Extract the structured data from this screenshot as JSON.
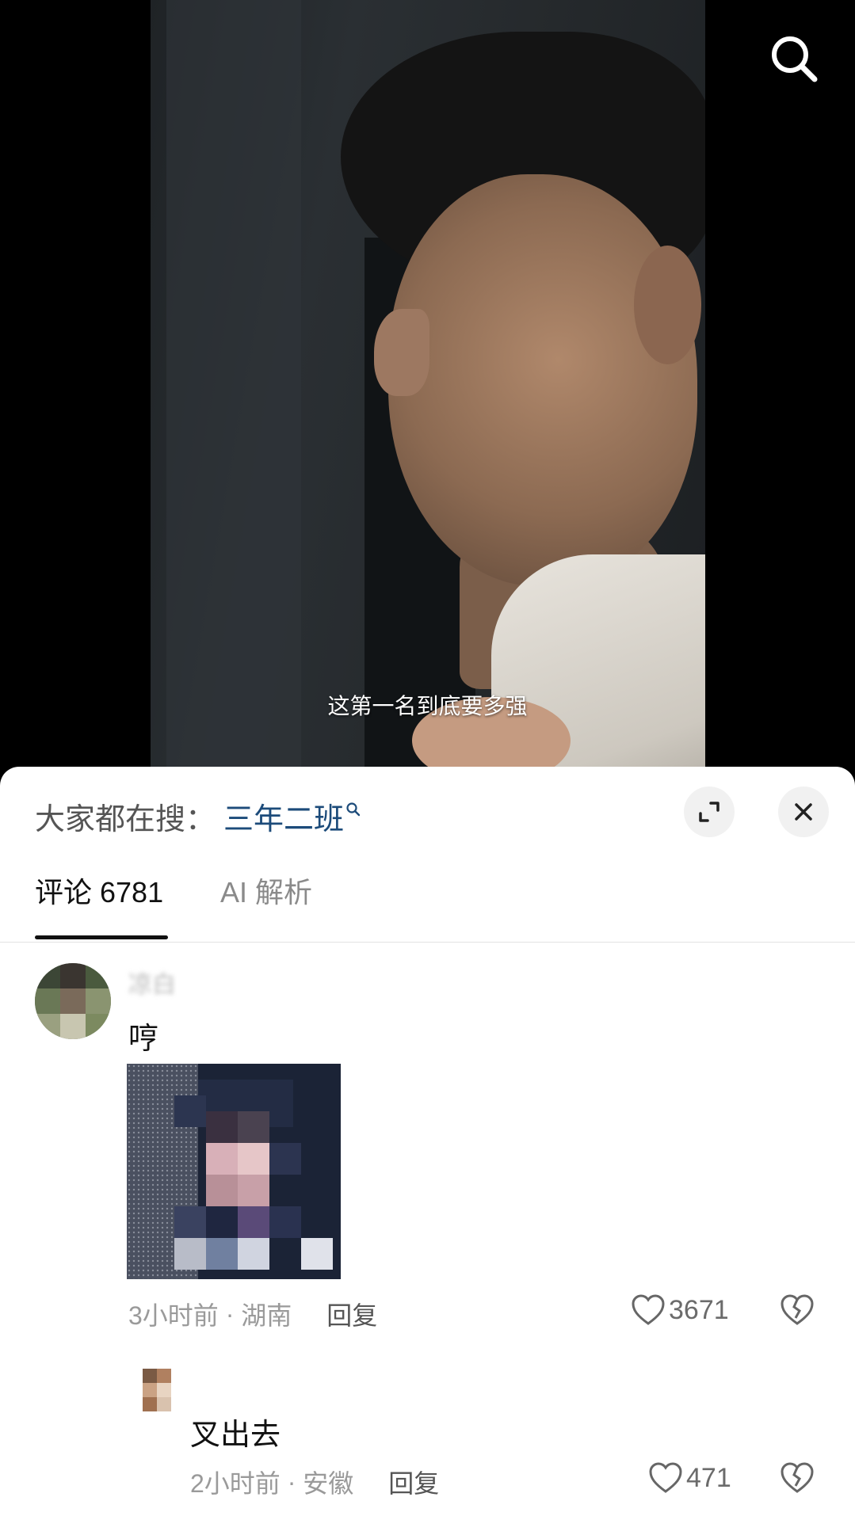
{
  "video": {
    "subtitle": "这第一名到底要多强"
  },
  "sheet": {
    "trending_prefix": "大家都在搜：",
    "trending_term": "三年二班"
  },
  "tabs": [
    {
      "label": "评论 6781",
      "active": true
    },
    {
      "label": "AI 解析",
      "active": false
    }
  ],
  "comments": [
    {
      "username": "凉白",
      "text": "哼",
      "has_image": true,
      "time": "3小时前",
      "location": "湖南",
      "reply_label": "回复",
      "likes": "3671"
    },
    {
      "username": "",
      "text": "叉出去",
      "has_image": false,
      "time": "2小时前",
      "location": "安徽",
      "reply_label": "回复",
      "likes": "471"
    }
  ],
  "colors": {
    "accent_link": "#1c4b7a",
    "meta_gray": "#9a9a9a",
    "sheet_bg": "#ffffff"
  },
  "icons": {
    "top_search": "search-icon",
    "trending_search": "search-icon",
    "expand": "expand-icon",
    "close": "close-icon",
    "like": "heart-icon",
    "dislike": "broken-heart-icon"
  }
}
